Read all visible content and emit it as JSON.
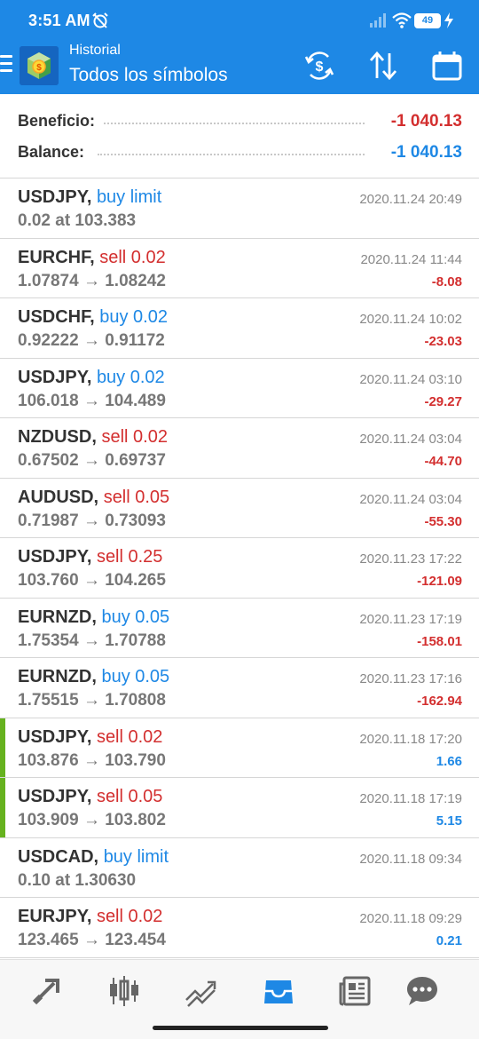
{
  "status_bar": {
    "time": "3:51 AM",
    "battery": "49",
    "icons": [
      "alarm-off-icon",
      "signal-icon",
      "wifi-icon",
      "battery-icon",
      "charging-icon"
    ]
  },
  "toolbar": {
    "subtitle": "Historial",
    "title": "Todos los símbolos",
    "icons": [
      "menu-icon",
      "metatrader-logo",
      "currency-exchange-icon",
      "sort-icon",
      "calendar-icon"
    ]
  },
  "summary": {
    "profit_label": "Beneficio:",
    "profit_value": "-1 040.13",
    "balance_label": "Balance:",
    "balance_value": "-1 040.13"
  },
  "orders": [
    {
      "symbol": "USDJPY,",
      "type": "buy limit",
      "side": "buy",
      "details": "0.02 at 103.383",
      "datetime": "2020.11.24 20:49",
      "profit": "",
      "marked": false
    },
    {
      "symbol": "EURCHF,",
      "type": "sell 0.02",
      "side": "sell",
      "details": "1.07874 → 1.08242",
      "datetime": "2020.11.24 11:44",
      "profit": "-8.08",
      "marked": false
    },
    {
      "symbol": "USDCHF,",
      "type": "buy 0.02",
      "side": "buy",
      "details": "0.92222 → 0.91172",
      "datetime": "2020.11.24 10:02",
      "profit": "-23.03",
      "marked": false
    },
    {
      "symbol": "USDJPY,",
      "type": "buy 0.02",
      "side": "buy",
      "details": "106.018 → 104.489",
      "datetime": "2020.11.24 03:10",
      "profit": "-29.27",
      "marked": false
    },
    {
      "symbol": "NZDUSD,",
      "type": "sell 0.02",
      "side": "sell",
      "details": "0.67502 → 0.69737",
      "datetime": "2020.11.24 03:04",
      "profit": "-44.70",
      "marked": false
    },
    {
      "symbol": "AUDUSD,",
      "type": "sell 0.05",
      "side": "sell",
      "details": "0.71987 → 0.73093",
      "datetime": "2020.11.24 03:04",
      "profit": "-55.30",
      "marked": false
    },
    {
      "symbol": "USDJPY,",
      "type": "sell 0.25",
      "side": "sell",
      "details": "103.760 → 104.265",
      "datetime": "2020.11.23 17:22",
      "profit": "-121.09",
      "marked": false
    },
    {
      "symbol": "EURNZD,",
      "type": "buy 0.05",
      "side": "buy",
      "details": "1.75354 → 1.70788",
      "datetime": "2020.11.23 17:19",
      "profit": "-158.01",
      "marked": false
    },
    {
      "symbol": "EURNZD,",
      "type": "buy 0.05",
      "side": "buy",
      "details": "1.75515 → 1.70808",
      "datetime": "2020.11.23 17:16",
      "profit": "-162.94",
      "marked": false
    },
    {
      "symbol": "USDJPY,",
      "type": "sell 0.02",
      "side": "sell",
      "details": "103.876 → 103.790",
      "datetime": "2020.11.18 17:20",
      "profit": "1.66",
      "marked": true
    },
    {
      "symbol": "USDJPY,",
      "type": "sell 0.05",
      "side": "sell",
      "details": "103.909 → 103.802",
      "datetime": "2020.11.18 17:19",
      "profit": "5.15",
      "marked": true
    },
    {
      "symbol": "USDCAD,",
      "type": "buy limit",
      "side": "buy",
      "details": "0.10 at 1.30630",
      "datetime": "2020.11.18 09:34",
      "profit": "",
      "marked": false
    },
    {
      "symbol": "EURJPY,",
      "type": "sell 0.02",
      "side": "sell",
      "details": "123.465 → 123.454",
      "datetime": "2020.11.18 09:29",
      "profit": "0.21",
      "marked": false
    }
  ],
  "bottom_nav": {
    "items": [
      "quotes-icon",
      "chart-icon",
      "trade-icon",
      "history-icon",
      "news-icon",
      "messages-icon"
    ],
    "active": "history-icon"
  },
  "colors": {
    "brand_blue": "#1e88e5",
    "sell_red": "#d32f2f",
    "loss_red": "#d32f2f",
    "profit_blue": "#1e88e5",
    "marker_green": "#66b21f"
  }
}
